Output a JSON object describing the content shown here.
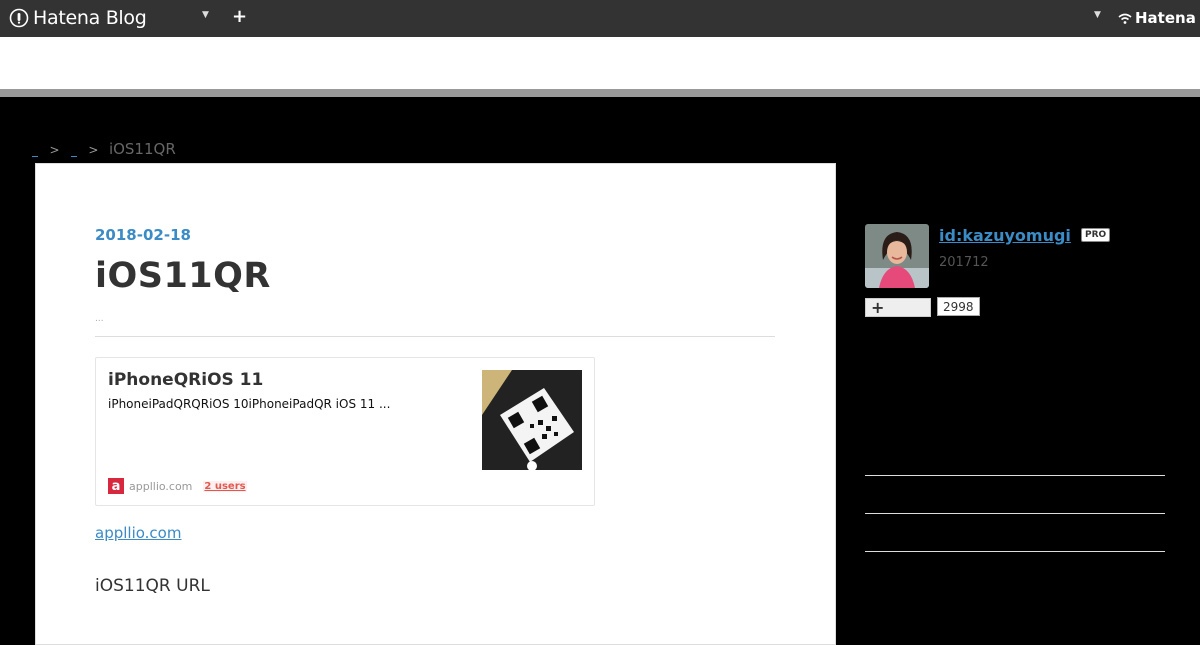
{
  "globalbar": {
    "logo_text": "Hatena Blog",
    "plus_label": "+",
    "hatena_label": "Hatena"
  },
  "breadcrumb": {
    "current": "iOS11QR"
  },
  "entry": {
    "date": "2018-02-18",
    "title": "iOS11QR",
    "meta": "...",
    "embed": {
      "title": "iPhoneQRiOS 11",
      "description": "iPhoneiPadQRQRiOS 10iPhoneiPadQR iOS 11 ...",
      "favicon_letter": "a",
      "domain": "appllio.com",
      "users": "2 users"
    },
    "link_text": "appllio.com",
    "body_text": "iOS11QR URL"
  },
  "sidebar": {
    "profile_id": "id:kazuyomugi",
    "pro_label": "PRO",
    "since": "201712",
    "subscribe_label": "+",
    "subscriber_count": "2998"
  },
  "colors": {
    "accent": "#3b8bc6",
    "header_bg": "#333333",
    "page_bg": "#000000",
    "favicon": "#d7283f"
  }
}
